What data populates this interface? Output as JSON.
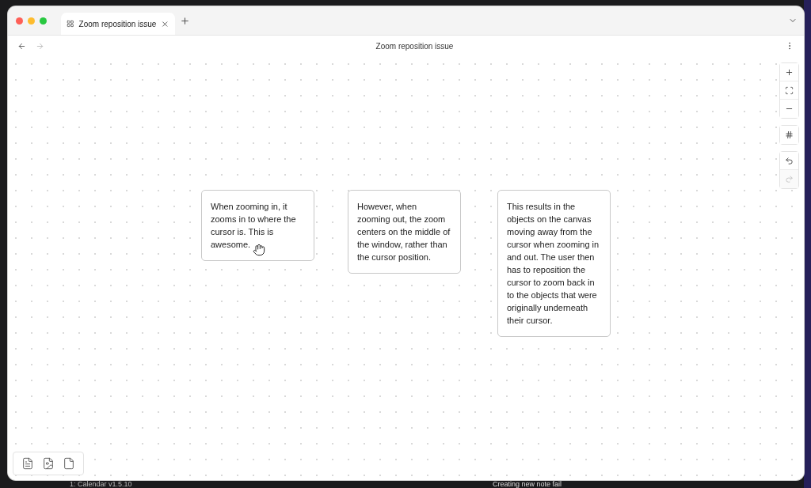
{
  "window": {
    "tab": {
      "title": "Zoom reposition issue",
      "selected": true
    },
    "title": "Zoom reposition issue"
  },
  "canvas": {
    "cards": [
      {
        "text": "When zooming in, it zooms in to where the cursor is. This is awesome."
      },
      {
        "text": "However, when zooming out, the zoom centers on the middle of the window, rather than the cursor position."
      },
      {
        "text": "This results in the objects on the canvas moving away from the cursor when zooming in and out. The user then has to reposition the cursor to zoom back in to the objects that were originally underneath their cursor."
      }
    ],
    "controls": [
      {
        "kind": "zoom-in",
        "disabled": false
      },
      {
        "kind": "fit",
        "disabled": false
      },
      {
        "kind": "zoom-out",
        "disabled": false
      },
      {
        "kind": "grid",
        "disabled": false
      },
      {
        "kind": "undo",
        "disabled": false
      },
      {
        "kind": "redo",
        "disabled": true
      }
    ]
  },
  "background": {
    "left_text": "1: Calendar v1.5.10",
    "right_text": "Creating new note fail"
  }
}
